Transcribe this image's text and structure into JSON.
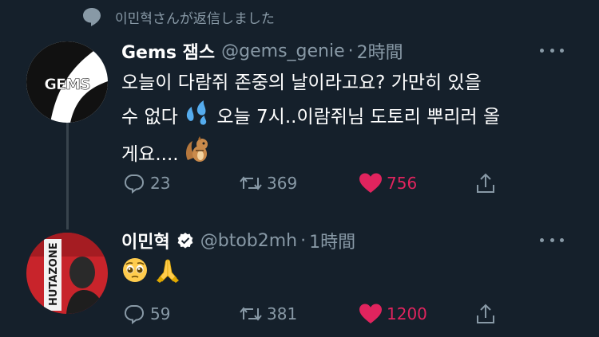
{
  "context": {
    "icon": "speech-bubble-icon",
    "text": "이민혁さんが返信しました"
  },
  "tweets": [
    {
      "name": "Gems 잼스",
      "handle": "@gems_genie",
      "dot": "·",
      "time": "2時間",
      "avatar_logo": "GEMS",
      "text_lines": [
        "오늘이 다람쥐 존중의 날이라고요? 가만히 있을",
        "수 없다",
        "오늘 7시..이람쥐님 도토리 뿌리러 올",
        "게요...."
      ],
      "emojis": [
        "sweat-droplets-emoji",
        "chipmunk-emoji"
      ],
      "reply_count": "23",
      "retweet_count": "369",
      "like_count": "756",
      "liked": true,
      "verified": false
    },
    {
      "name": "이민혁",
      "handle": "@btob2mh",
      "dot": "·",
      "time": "1時間",
      "avatar_logo": "HUTAZONE",
      "emojis": [
        "pleading-face-emoji",
        "folded-hands-emoji"
      ],
      "reply_count": "59",
      "retweet_count": "381",
      "like_count": "1200",
      "liked": true,
      "verified": true
    }
  ],
  "colors": {
    "background": "#15202b",
    "muted": "#8899a6",
    "like": "#e0245e",
    "verified": "#ffffff"
  }
}
